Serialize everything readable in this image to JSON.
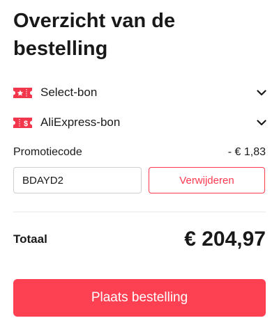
{
  "summary": {
    "title": "Overzicht van de bestelling"
  },
  "coupons": [
    {
      "label": "Select-bon",
      "icon": "select-coupon-icon",
      "icon_color": "#f2364b"
    },
    {
      "label": "AliExpress-bon",
      "icon": "aliexpress-coupon-icon",
      "icon_color": "#f2364b"
    }
  ],
  "promo": {
    "label": "Promotiecode",
    "discount": "- € 1,83",
    "code_value": "BDAYD2",
    "remove_label": "Verwijderen"
  },
  "total": {
    "label": "Totaal",
    "amount": "€ 204,97"
  },
  "actions": {
    "place_order_label": "Plaats bestelling"
  },
  "colors": {
    "accent": "#fd4152",
    "text": "#191919",
    "border": "#cfcfcf"
  }
}
